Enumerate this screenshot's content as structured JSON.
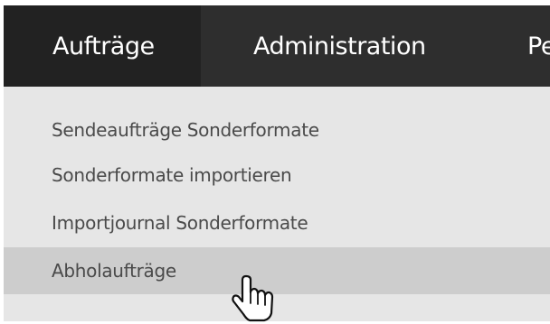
{
  "nav": {
    "items": [
      {
        "label": "Aufträge"
      },
      {
        "label": "Administration"
      },
      {
        "label": "Pe"
      }
    ]
  },
  "dropdown": {
    "items": [
      {
        "label": "Sendeaufträge Sonderformate"
      },
      {
        "label": "Sonderformate importieren"
      },
      {
        "label": "Importjournal Sonderformate"
      },
      {
        "label": "Abholaufträge"
      }
    ],
    "hovered_item": "Abholaufträge"
  },
  "colors": {
    "nav_background": "#2e2e2e",
    "nav_active_background": "#222222",
    "dropdown_background": "#e6e6e6",
    "hover_background": "#cdcdcd",
    "menu_text": "#4a4a4a"
  },
  "icons": {
    "cursor": "hand-pointer-icon"
  }
}
